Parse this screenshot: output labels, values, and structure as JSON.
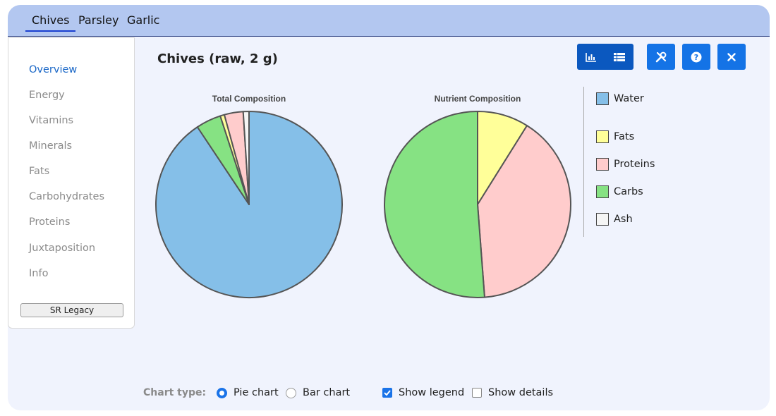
{
  "tabs": [
    {
      "label": "Chives",
      "active": true
    },
    {
      "label": "Parsley",
      "active": false
    },
    {
      "label": "Garlic",
      "active": false
    }
  ],
  "sidebar": {
    "items": [
      {
        "label": "Overview",
        "active": true
      },
      {
        "label": "Energy"
      },
      {
        "label": "Vitamins"
      },
      {
        "label": "Minerals"
      },
      {
        "label": "Fats"
      },
      {
        "label": "Carbohydrates"
      },
      {
        "label": "Proteins"
      },
      {
        "label": "Juxtaposition"
      },
      {
        "label": "Info"
      }
    ],
    "source_button": "SR Legacy"
  },
  "header": {
    "title": "Chives (raw, 2 g)",
    "toolbar": [
      {
        "icon": "chart-view-icon",
        "selected": true
      },
      {
        "icon": "table-view-icon",
        "selected": true
      },
      {
        "icon": "tools-icon"
      },
      {
        "icon": "help-icon"
      },
      {
        "icon": "close-icon"
      }
    ]
  },
  "colors": {
    "water": "#85bfe8",
    "fats": "#ffff99",
    "proteins": "#ffcccc",
    "carbs": "#86e283",
    "ash": "#f5f5f5",
    "accent": "#1473e6"
  },
  "chart_data": [
    {
      "type": "pie",
      "title": "Total Composition",
      "categories": [
        "Water",
        "Carbs",
        "Fats",
        "Proteins",
        "Ash"
      ],
      "values": [
        90.65,
        4.35,
        0.73,
        3.27,
        1.0
      ]
    },
    {
      "type": "pie",
      "title": "Nutrient Composition",
      "categories": [
        "Fats",
        "Proteins",
        "Carbs"
      ],
      "values": [
        8.9,
        39.9,
        51.2
      ]
    }
  ],
  "legend": {
    "items": [
      {
        "label": "Water"
      },
      {
        "label": "Fats"
      },
      {
        "label": "Proteins"
      },
      {
        "label": "Carbs"
      },
      {
        "label": "Ash"
      }
    ]
  },
  "controls": {
    "chart_type_label": "Chart type:",
    "pie_label": "Pie chart",
    "bar_label": "Bar chart",
    "show_legend_label": "Show legend",
    "show_details_label": "Show details",
    "chart_type_selected": "pie",
    "show_legend": true,
    "show_details": false
  }
}
